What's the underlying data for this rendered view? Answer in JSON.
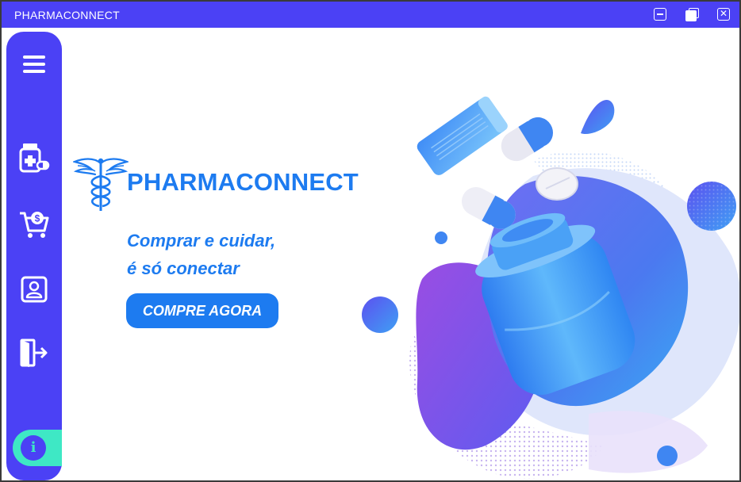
{
  "window": {
    "title": "PHARMACONNECT",
    "controls": {
      "minimize_icon": "minimize-icon",
      "maximize_icon": "maximize-icon",
      "close_symbol": "✕"
    }
  },
  "sidebar": {
    "items": [
      {
        "icon": "hamburger-menu-icon"
      },
      {
        "icon": "medicine-icon"
      },
      {
        "icon": "shopping-cart-icon"
      },
      {
        "icon": "profile-icon"
      },
      {
        "icon": "logout-icon"
      }
    ],
    "info_symbol": "i"
  },
  "hero": {
    "brand": "PHARMACONNECT",
    "tagline_line1": "Comprar e cuidar,",
    "tagline_line2": "é só conectar",
    "cta_label": "COMPRE AGORA",
    "illustration": "medicine-bottle-illustration"
  },
  "colors": {
    "primary": "#4b41f5",
    "accent": "#1d7bf0",
    "info_accent": "#3ee8c5",
    "background": "#ffffff"
  }
}
